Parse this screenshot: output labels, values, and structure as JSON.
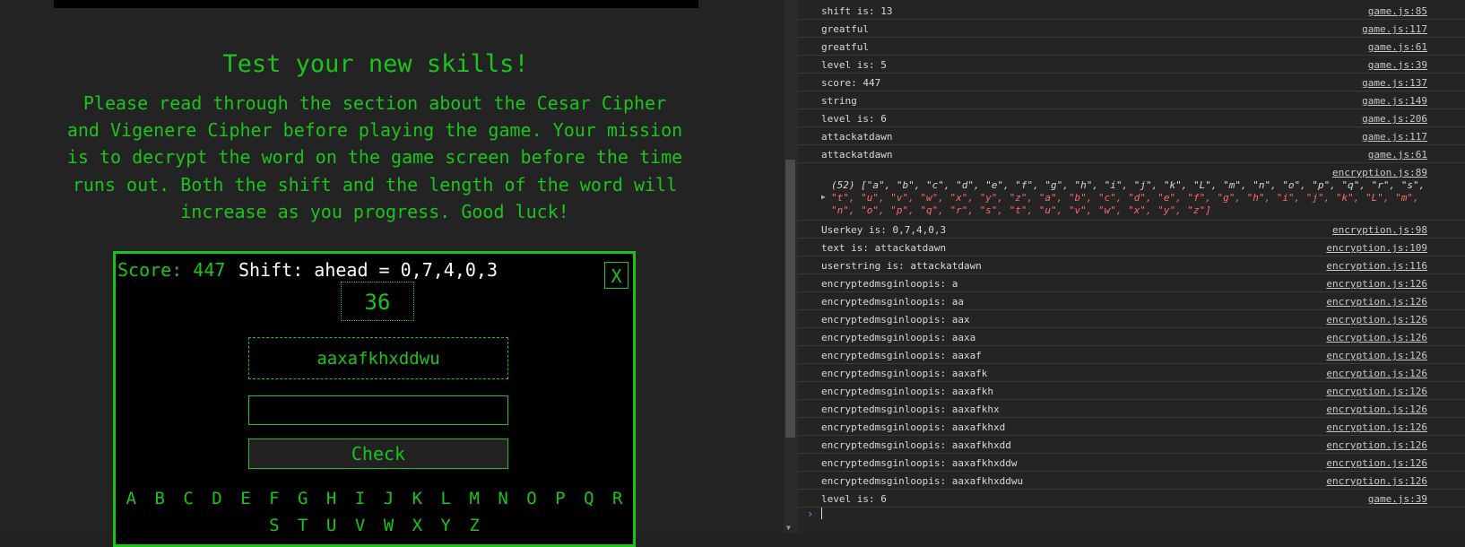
{
  "game_page": {
    "heading": "Test your new skills!",
    "intro": "Please read through the section about the Cesar Cipher and Vigenere Cipher before playing the game. Your mission is to decrypt the word on the game screen before the time runs out. Both the shift and the length of the word will increase as you progress. Good luck!",
    "score_label": "Score: 447",
    "shift_label": "Shift: ahead = 0,7,4,0,3",
    "close_label": "X",
    "timer": "36",
    "cipher_word": "aaxafkhxddwu",
    "answer_value": "",
    "check_label": "Check",
    "alphabet": [
      "A",
      "B",
      "C",
      "D",
      "E",
      "F",
      "G",
      "H",
      "I",
      "J",
      "K",
      "L",
      "M",
      "N",
      "O",
      "P",
      "Q",
      "R",
      "S",
      "T",
      "U",
      "V",
      "W",
      "X",
      "Y",
      "Z"
    ]
  },
  "console": {
    "rows_top": [
      {
        "msg": "shift is: 13",
        "src": "game.js:85"
      },
      {
        "msg": "greatful",
        "src": "game.js:117"
      },
      {
        "msg": "greatful",
        "src": "game.js:61"
      },
      {
        "msg": "level is: 5",
        "src": "game.js:39"
      },
      {
        "msg": "score: 447",
        "src": "game.js:137"
      },
      {
        "msg": "string",
        "src": "game.js:149"
      },
      {
        "msg": "level is: 6",
        "src": "game.js:206"
      },
      {
        "msg": "attackatdawn",
        "src": "game.js:117"
      },
      {
        "msg": "attackatdawn",
        "src": "game.js:61"
      }
    ],
    "array_log": {
      "src": "encryption.js:89",
      "line1": "(52) [\"a\", \"b\", \"c\", \"d\", \"e\", \"f\", \"g\", \"h\", \"i\", \"j\", \"k\", \"L\", \"m\", \"n\", \"o\", \"p\", \"q\", \"r\", \"s\",",
      "line2": "\"t\", \"u\", \"v\", \"w\", \"x\", \"y\", \"z\", \"a\", \"b\", \"c\", \"d\", \"e\", \"f\", \"g\", \"h\", \"i\", \"j\", \"k\", \"L\", \"m\",",
      "line3": "\"n\", \"o\", \"p\", \"q\", \"r\", \"s\", \"t\", \"u\", \"v\", \"w\", \"x\", \"y\", \"z\"]"
    },
    "rows_bottom": [
      {
        "msg": "Userkey is: 0,7,4,0,3",
        "src": "encryption.js:98"
      },
      {
        "msg": "text is: attackatdawn",
        "src": "encryption.js:109"
      },
      {
        "msg": "userstring is: attackatdawn",
        "src": "encryption.js:116"
      },
      {
        "msg": "encryptedmsginloopis: a",
        "src": "encryption.js:126"
      },
      {
        "msg": "encryptedmsginloopis: aa",
        "src": "encryption.js:126"
      },
      {
        "msg": "encryptedmsginloopis: aax",
        "src": "encryption.js:126"
      },
      {
        "msg": "encryptedmsginloopis: aaxa",
        "src": "encryption.js:126"
      },
      {
        "msg": "encryptedmsginloopis: aaxaf",
        "src": "encryption.js:126"
      },
      {
        "msg": "encryptedmsginloopis: aaxafk",
        "src": "encryption.js:126"
      },
      {
        "msg": "encryptedmsginloopis: aaxafkh",
        "src": "encryption.js:126"
      },
      {
        "msg": "encryptedmsginloopis: aaxafkhx",
        "src": "encryption.js:126"
      },
      {
        "msg": "encryptedmsginloopis: aaxafkhxd",
        "src": "encryption.js:126"
      },
      {
        "msg": "encryptedmsginloopis: aaxafkhxdd",
        "src": "encryption.js:126"
      },
      {
        "msg": "encryptedmsginloopis: aaxafkhxddw",
        "src": "encryption.js:126"
      },
      {
        "msg": "encryptedmsginloopis: aaxafkhxddwu",
        "src": "encryption.js:126"
      },
      {
        "msg": "level is: 6",
        "src": "game.js:39"
      }
    ],
    "prompt_symbol": "›",
    "expand_icon": "triangle-right-icon",
    "colors": {
      "accent_green": "#1bc41b",
      "array_string_red": "#ff6a6a",
      "prompt_blue": "#4d9cf5"
    }
  }
}
